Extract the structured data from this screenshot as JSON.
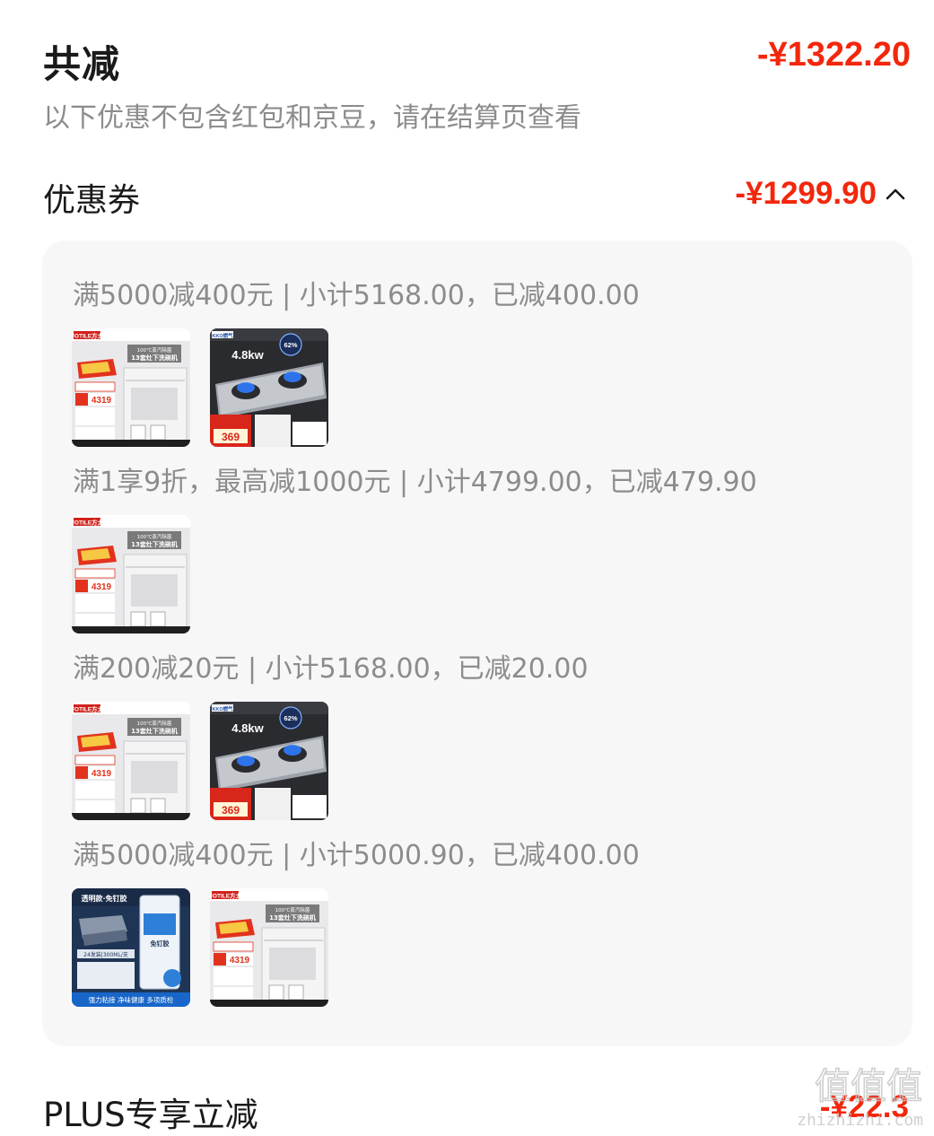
{
  "summary": {
    "title": "共减",
    "amount": "-¥1322.20",
    "note": "以下优惠不包含红包和京豆，请在结算页查看"
  },
  "coupons": {
    "title": "优惠券",
    "amount": "-¥1299.90",
    "expand_icon": "chevron-up-icon",
    "groups": [
      {
        "text": "满5000减400元 | 小计5168.00，已减400.00",
        "products": [
          "dishwasher",
          "gas-stove"
        ]
      },
      {
        "text": "满1享9折，最高减1000元 | 小计4799.00，已减479.90",
        "products": [
          "dishwasher"
        ]
      },
      {
        "text": "满200减20元 | 小计5168.00，已减20.00",
        "products": [
          "dishwasher",
          "gas-stove"
        ]
      },
      {
        "text": "满5000减400元 | 小计5000.90，已减400.00",
        "products": [
          "glue",
          "dishwasher"
        ]
      }
    ]
  },
  "products": {
    "dishwasher": {
      "brand": "FOTILE方太",
      "headline": "13套灶下洗碗机",
      "subline": "100℃蒸汽除菌",
      "price": "4319"
    },
    "gas-stove": {
      "brand": "KKO燃气",
      "power": "4.8kw",
      "efficiency": "62%",
      "price": "369"
    },
    "glue": {
      "tag": "透明款·免钉胶",
      "spec": "24发装|300ML/支",
      "label": "免钉胶",
      "footer": "强力粘接 净味健康 多项质检"
    }
  },
  "plus": {
    "title": "PLUS专享立减",
    "amount": "-¥22.3"
  },
  "watermark": {
    "glyphs": "值值值",
    "domain": "zhizhizhi.com"
  },
  "colors": {
    "price_red": "#f2270c",
    "text_dark": "#1a1a1a",
    "text_gray": "#8c8c8c",
    "panel_bg": "#f7f7f7"
  }
}
